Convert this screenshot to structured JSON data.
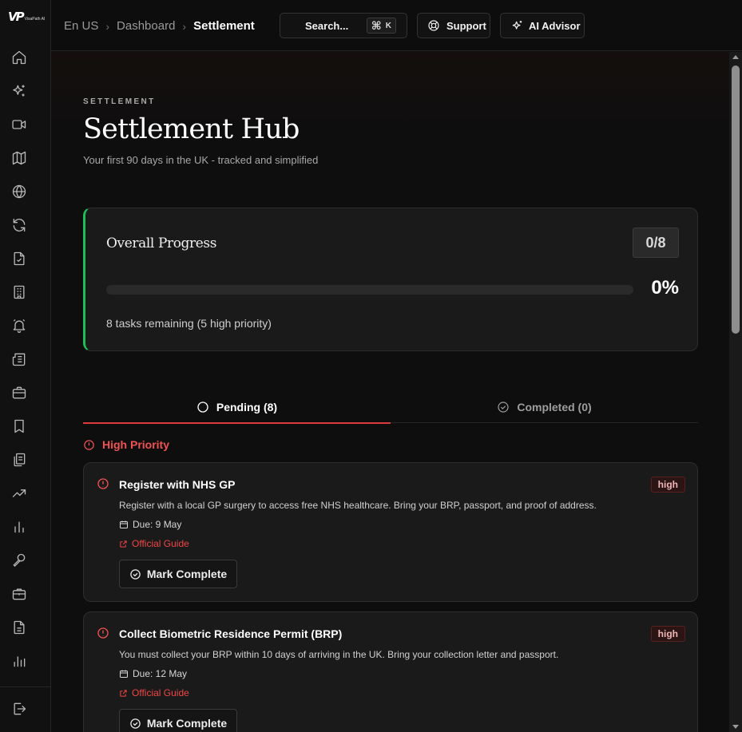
{
  "app": {
    "logo_mark": "VP",
    "logo_text": "VisaPath AI"
  },
  "breadcrumb": {
    "items": [
      "En US",
      "Dashboard"
    ],
    "current": "Settlement"
  },
  "topbar": {
    "search_label": "Search...",
    "search_shortcut_symbol": "⌘",
    "search_shortcut_key": "K",
    "support_label": "Support",
    "advisor_label": "AI Advisor"
  },
  "sidebar": {
    "icons": [
      "home-icon",
      "sparkles-icon",
      "video-icon",
      "map-icon",
      "globe-icon",
      "refresh-icon",
      "document-check-icon",
      "building-icon",
      "bell-icon",
      "newspaper-icon",
      "briefcase-icon",
      "bookmark-icon",
      "clipboard-icon",
      "trending-up-icon",
      "bar-chart-icon",
      "microphone-icon",
      "briefcase-alt-icon",
      "file-text-icon",
      "bar-chart-alt-icon"
    ],
    "logout_icon": "logout-icon"
  },
  "page": {
    "eyebrow": "SETTLEMENT",
    "title": "Settlement Hub",
    "subtitle": "Your first 90 days in the UK - tracked and simplified"
  },
  "progress": {
    "title": "Overall Progress",
    "count": "0/8",
    "percent_label": "0%",
    "fraction": 0,
    "remaining": "8 tasks remaining (5 high priority)",
    "accent": "#1fbf57"
  },
  "tabs": [
    {
      "label": "Pending (8)",
      "active": true
    },
    {
      "label": "Completed (0)",
      "active": false
    }
  ],
  "section": {
    "label": "High Priority",
    "color": "#f05252"
  },
  "tasks": [
    {
      "title": "Register with NHS GP",
      "priority": "high",
      "description": "Register with a local GP surgery to access free NHS healthcare. Bring your BRP, passport, and proof of address.",
      "due": "Due: 9 May",
      "guide": "Official Guide",
      "button": "Mark Complete"
    },
    {
      "title": "Collect Biometric Residence Permit (BRP)",
      "priority": "high",
      "description": "You must collect your BRP within 10 days of arriving in the UK. Bring your collection letter and passport.",
      "due": "Due: 12 May",
      "guide": "Official Guide",
      "button": "Mark Complete"
    }
  ]
}
